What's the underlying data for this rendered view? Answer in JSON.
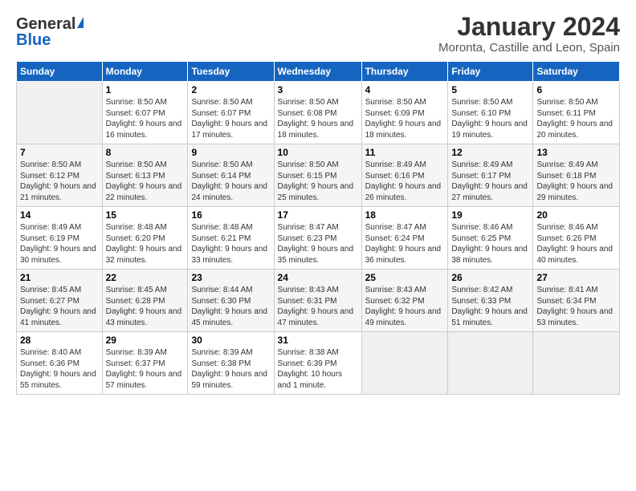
{
  "logo": {
    "general": "General",
    "blue": "Blue"
  },
  "title": "January 2024",
  "location": "Moronta, Castille and Leon, Spain",
  "weekdays": [
    "Sunday",
    "Monday",
    "Tuesday",
    "Wednesday",
    "Thursday",
    "Friday",
    "Saturday"
  ],
  "weeks": [
    [
      {
        "day": "",
        "empty": true
      },
      {
        "day": "1",
        "sunrise": "Sunrise: 8:50 AM",
        "sunset": "Sunset: 6:07 PM",
        "daylight": "Daylight: 9 hours and 16 minutes."
      },
      {
        "day": "2",
        "sunrise": "Sunrise: 8:50 AM",
        "sunset": "Sunset: 6:07 PM",
        "daylight": "Daylight: 9 hours and 17 minutes."
      },
      {
        "day": "3",
        "sunrise": "Sunrise: 8:50 AM",
        "sunset": "Sunset: 6:08 PM",
        "daylight": "Daylight: 9 hours and 18 minutes."
      },
      {
        "day": "4",
        "sunrise": "Sunrise: 8:50 AM",
        "sunset": "Sunset: 6:09 PM",
        "daylight": "Daylight: 9 hours and 18 minutes."
      },
      {
        "day": "5",
        "sunrise": "Sunrise: 8:50 AM",
        "sunset": "Sunset: 6:10 PM",
        "daylight": "Daylight: 9 hours and 19 minutes."
      },
      {
        "day": "6",
        "sunrise": "Sunrise: 8:50 AM",
        "sunset": "Sunset: 6:11 PM",
        "daylight": "Daylight: 9 hours and 20 minutes."
      }
    ],
    [
      {
        "day": "7",
        "sunrise": "Sunrise: 8:50 AM",
        "sunset": "Sunset: 6:12 PM",
        "daylight": "Daylight: 9 hours and 21 minutes."
      },
      {
        "day": "8",
        "sunrise": "Sunrise: 8:50 AM",
        "sunset": "Sunset: 6:13 PM",
        "daylight": "Daylight: 9 hours and 22 minutes."
      },
      {
        "day": "9",
        "sunrise": "Sunrise: 8:50 AM",
        "sunset": "Sunset: 6:14 PM",
        "daylight": "Daylight: 9 hours and 24 minutes."
      },
      {
        "day": "10",
        "sunrise": "Sunrise: 8:50 AM",
        "sunset": "Sunset: 6:15 PM",
        "daylight": "Daylight: 9 hours and 25 minutes."
      },
      {
        "day": "11",
        "sunrise": "Sunrise: 8:49 AM",
        "sunset": "Sunset: 6:16 PM",
        "daylight": "Daylight: 9 hours and 26 minutes."
      },
      {
        "day": "12",
        "sunrise": "Sunrise: 8:49 AM",
        "sunset": "Sunset: 6:17 PM",
        "daylight": "Daylight: 9 hours and 27 minutes."
      },
      {
        "day": "13",
        "sunrise": "Sunrise: 8:49 AM",
        "sunset": "Sunset: 6:18 PM",
        "daylight": "Daylight: 9 hours and 29 minutes."
      }
    ],
    [
      {
        "day": "14",
        "sunrise": "Sunrise: 8:49 AM",
        "sunset": "Sunset: 6:19 PM",
        "daylight": "Daylight: 9 hours and 30 minutes."
      },
      {
        "day": "15",
        "sunrise": "Sunrise: 8:48 AM",
        "sunset": "Sunset: 6:20 PM",
        "daylight": "Daylight: 9 hours and 32 minutes."
      },
      {
        "day": "16",
        "sunrise": "Sunrise: 8:48 AM",
        "sunset": "Sunset: 6:21 PM",
        "daylight": "Daylight: 9 hours and 33 minutes."
      },
      {
        "day": "17",
        "sunrise": "Sunrise: 8:47 AM",
        "sunset": "Sunset: 6:23 PM",
        "daylight": "Daylight: 9 hours and 35 minutes."
      },
      {
        "day": "18",
        "sunrise": "Sunrise: 8:47 AM",
        "sunset": "Sunset: 6:24 PM",
        "daylight": "Daylight: 9 hours and 36 minutes."
      },
      {
        "day": "19",
        "sunrise": "Sunrise: 8:46 AM",
        "sunset": "Sunset: 6:25 PM",
        "daylight": "Daylight: 9 hours and 38 minutes."
      },
      {
        "day": "20",
        "sunrise": "Sunrise: 8:46 AM",
        "sunset": "Sunset: 6:26 PM",
        "daylight": "Daylight: 9 hours and 40 minutes."
      }
    ],
    [
      {
        "day": "21",
        "sunrise": "Sunrise: 8:45 AM",
        "sunset": "Sunset: 6:27 PM",
        "daylight": "Daylight: 9 hours and 41 minutes."
      },
      {
        "day": "22",
        "sunrise": "Sunrise: 8:45 AM",
        "sunset": "Sunset: 6:28 PM",
        "daylight": "Daylight: 9 hours and 43 minutes."
      },
      {
        "day": "23",
        "sunrise": "Sunrise: 8:44 AM",
        "sunset": "Sunset: 6:30 PM",
        "daylight": "Daylight: 9 hours and 45 minutes."
      },
      {
        "day": "24",
        "sunrise": "Sunrise: 8:43 AM",
        "sunset": "Sunset: 6:31 PM",
        "daylight": "Daylight: 9 hours and 47 minutes."
      },
      {
        "day": "25",
        "sunrise": "Sunrise: 8:43 AM",
        "sunset": "Sunset: 6:32 PM",
        "daylight": "Daylight: 9 hours and 49 minutes."
      },
      {
        "day": "26",
        "sunrise": "Sunrise: 8:42 AM",
        "sunset": "Sunset: 6:33 PM",
        "daylight": "Daylight: 9 hours and 51 minutes."
      },
      {
        "day": "27",
        "sunrise": "Sunrise: 8:41 AM",
        "sunset": "Sunset: 6:34 PM",
        "daylight": "Daylight: 9 hours and 53 minutes."
      }
    ],
    [
      {
        "day": "28",
        "sunrise": "Sunrise: 8:40 AM",
        "sunset": "Sunset: 6:36 PM",
        "daylight": "Daylight: 9 hours and 55 minutes."
      },
      {
        "day": "29",
        "sunrise": "Sunrise: 8:39 AM",
        "sunset": "Sunset: 6:37 PM",
        "daylight": "Daylight: 9 hours and 57 minutes."
      },
      {
        "day": "30",
        "sunrise": "Sunrise: 8:39 AM",
        "sunset": "Sunset: 6:38 PM",
        "daylight": "Daylight: 9 hours and 59 minutes."
      },
      {
        "day": "31",
        "sunrise": "Sunrise: 8:38 AM",
        "sunset": "Sunset: 6:39 PM",
        "daylight": "Daylight: 10 hours and 1 minute."
      },
      {
        "day": "",
        "empty": true
      },
      {
        "day": "",
        "empty": true
      },
      {
        "day": "",
        "empty": true
      }
    ]
  ]
}
